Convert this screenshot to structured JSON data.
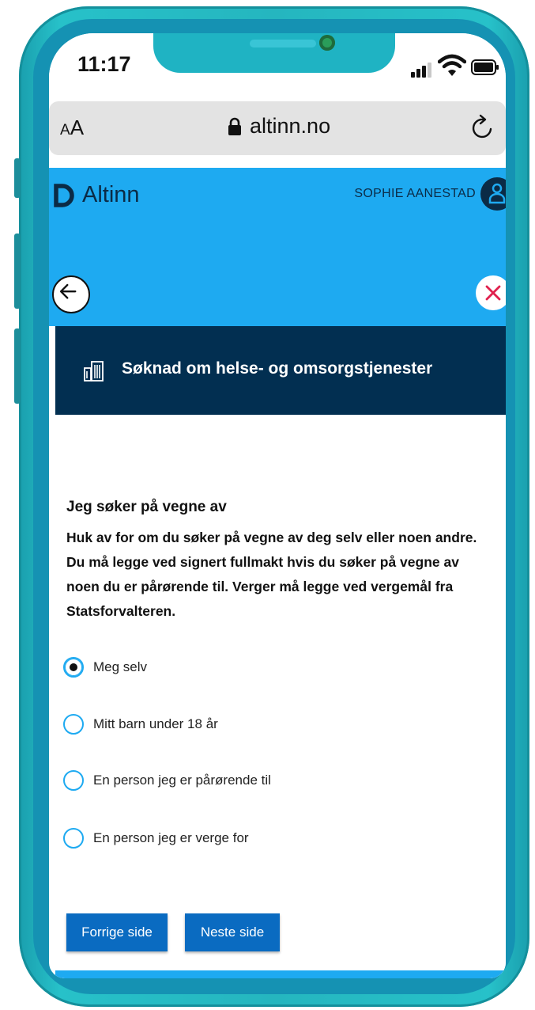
{
  "status_bar": {
    "time": "11:17"
  },
  "browser": {
    "text_size_label_small": "A",
    "text_size_label_large": "A",
    "url": "altinn.no"
  },
  "header": {
    "logo_text": "Altinn",
    "user_name": "SOPHIE AANESTAD"
  },
  "banner": {
    "title": "Søknad om helse- og omsorgstjenester"
  },
  "form": {
    "question": "Jeg søker på vegne av",
    "help_text": "Huk av for om du søker på vegne av deg selv eller noen andre. Du må legge ved signert fullmakt hvis du søker på vegne av noen du er pårørende til. Verger må legge ved vergemål fra Statsforvalteren.",
    "options": [
      {
        "label": "Meg selv",
        "checked": true
      },
      {
        "label": "Mitt barn under 18 år",
        "checked": false
      },
      {
        "label": "En person jeg er pårørende til",
        "checked": false
      },
      {
        "label": "En person jeg er verge for",
        "checked": false
      }
    ],
    "prev_label": "Forrige side",
    "next_label": "Neste side"
  },
  "colors": {
    "header_blue": "#1eaaf1",
    "banner_navy": "#022f51",
    "button_blue": "#0a6bc1",
    "frame_teal": "#27c1c9"
  },
  "icons": [
    "lock-icon",
    "reload-icon",
    "user-icon",
    "back-arrow-icon",
    "close-icon",
    "building-icon"
  ]
}
